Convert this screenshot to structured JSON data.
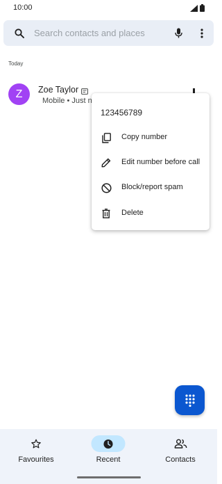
{
  "status_bar": {
    "time": "10:00"
  },
  "search": {
    "placeholder": "Search contacts and places"
  },
  "section": {
    "label": "Today"
  },
  "call_log": [
    {
      "avatar_letter": "Z",
      "name": "Zoe Taylor",
      "meta": "Mobile • Just now",
      "avatar_color": "#a142f4"
    }
  ],
  "context_menu": {
    "number": "123456789",
    "items": [
      {
        "label": "Copy number",
        "icon": "copy-icon"
      },
      {
        "label": "Edit number before call",
        "icon": "pencil-icon"
      },
      {
        "label": "Block/report spam",
        "icon": "block-icon"
      },
      {
        "label": "Delete",
        "icon": "trash-icon"
      }
    ]
  },
  "bottom_nav": {
    "tabs": [
      {
        "label": "Favourites",
        "icon": "star-icon",
        "active": false
      },
      {
        "label": "Recent",
        "icon": "clock-icon",
        "active": true
      },
      {
        "label": "Contacts",
        "icon": "people-icon",
        "active": false
      }
    ]
  },
  "colors": {
    "accent": "#0b57d0",
    "active_pill": "#c2e7ff",
    "search_bg": "#e9eef6",
    "nav_bg": "#eff3fa"
  }
}
